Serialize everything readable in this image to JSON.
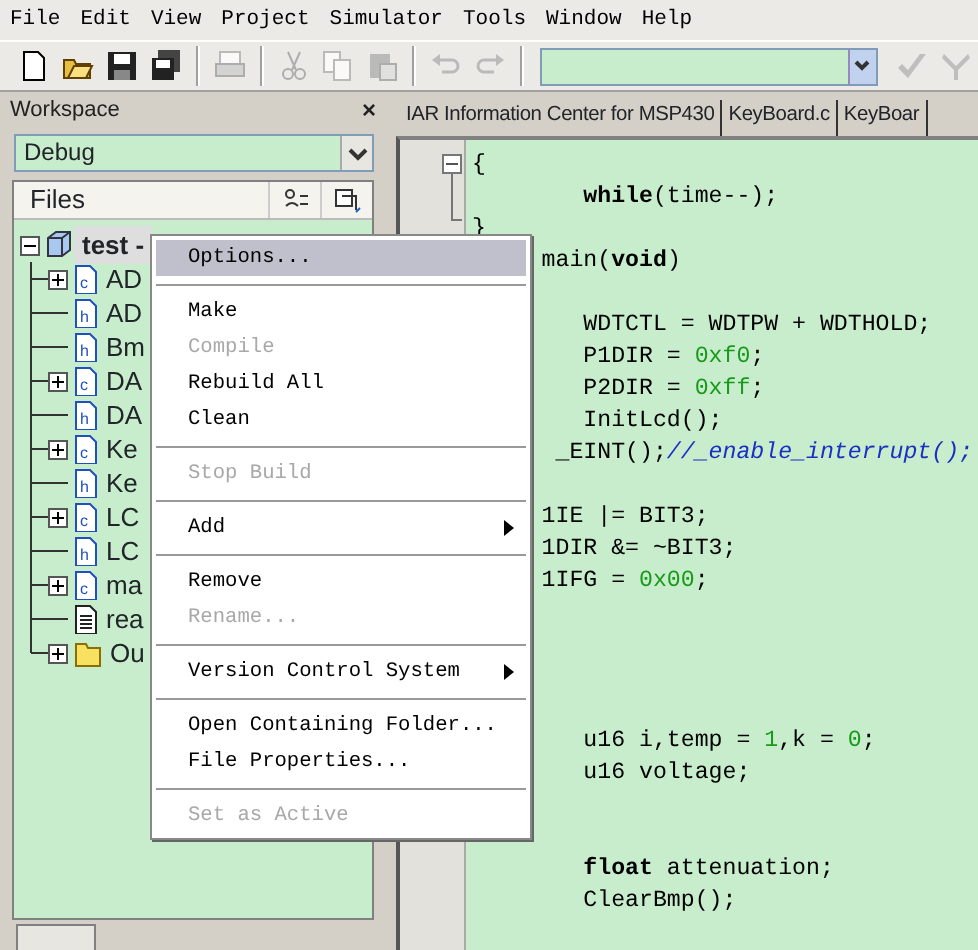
{
  "menu_bar": [
    {
      "label": "File"
    },
    {
      "label": "Edit"
    },
    {
      "label": "View"
    },
    {
      "label": "Project"
    },
    {
      "label": "Simulator"
    },
    {
      "label": "Tools"
    },
    {
      "label": "Window"
    },
    {
      "label": "Help"
    }
  ],
  "toolbar": [
    [
      {
        "kind": "new",
        "disabled": false
      },
      {
        "kind": "open",
        "disabled": false
      },
      {
        "kind": "save",
        "disabled": false
      },
      {
        "kind": "save_all",
        "disabled": false
      }
    ],
    [
      {
        "kind": "print",
        "disabled": true
      }
    ],
    [
      {
        "kind": "cut",
        "disabled": true
      },
      {
        "kind": "copy",
        "disabled": true
      },
      {
        "kind": "paste",
        "disabled": true
      }
    ],
    [
      {
        "kind": "undo",
        "disabled": true
      },
      {
        "kind": "redo",
        "disabled": true
      }
    ],
    [
      {
        "kind": "combo",
        "disabled": false
      },
      {
        "kind": "check",
        "disabled": true
      },
      {
        "kind": "fork",
        "disabled": true
      }
    ]
  ],
  "workspace": {
    "title": "Workspace",
    "close": "×",
    "configuration": "Debug",
    "files_header": "Files",
    "tree": [
      {
        "label": "test -",
        "kind": "project",
        "selected": true,
        "expandable": true,
        "expanded": true,
        "children": [
          {
            "label": "AD",
            "kind": "c",
            "selected": false,
            "expandable": true,
            "expanded": false
          },
          {
            "label": "AD",
            "kind": "h",
            "selected": false,
            "expandable": false
          },
          {
            "label": "Bm",
            "kind": "h",
            "selected": false,
            "expandable": false
          },
          {
            "label": "DA",
            "kind": "c",
            "selected": false,
            "expandable": true,
            "expanded": false
          },
          {
            "label": "DA",
            "kind": "h",
            "selected": false,
            "expandable": false
          },
          {
            "label": "Ke",
            "kind": "c",
            "selected": false,
            "expandable": true,
            "expanded": false
          },
          {
            "label": "Ke",
            "kind": "h",
            "selected": false,
            "expandable": false
          },
          {
            "label": "LC",
            "kind": "c",
            "selected": false,
            "expandable": true,
            "expanded": false
          },
          {
            "label": "LC",
            "kind": "h",
            "selected": false,
            "expandable": false
          },
          {
            "label": "ma",
            "kind": "c",
            "selected": false,
            "expandable": true,
            "expanded": false
          },
          {
            "label": "rea",
            "kind": "text",
            "selected": false,
            "expandable": false
          },
          {
            "label": "Ou",
            "kind": "folder",
            "selected": false,
            "expandable": true,
            "expanded": false
          }
        ]
      }
    ]
  },
  "editor": {
    "tabs": [
      {
        "label": "IAR Information Center for MSP430"
      },
      {
        "label": "KeyBoard.c"
      },
      {
        "label": "KeyBoar"
      }
    ],
    "lines": [
      {
        "kind": "code",
        "tokens": [
          {
            "text": "{",
            "kind": "plain"
          }
        ]
      },
      {
        "kind": "code",
        "tokens": [
          {
            "text": "        while",
            "kind": "keyword"
          },
          {
            "text": "(time--);",
            "kind": "plain"
          }
        ]
      },
      {
        "kind": "code",
        "tokens": [
          {
            "text": "}",
            "kind": "plain"
          }
        ]
      },
      {
        "kind": "code",
        "tokens": [
          {
            "text": "     main(",
            "kind": "plain"
          },
          {
            "text": "void",
            "kind": "keyword"
          },
          {
            "text": ")",
            "kind": "plain"
          }
        ]
      },
      {
        "kind": "blank"
      },
      {
        "kind": "code",
        "tokens": [
          {
            "text": "        WDTCTL = WDTPW + WDTHOLD;",
            "kind": "plain"
          }
        ]
      },
      {
        "kind": "code",
        "tokens": [
          {
            "text": "        P1DIR = ",
            "kind": "plain"
          },
          {
            "text": "0xf0",
            "kind": "number"
          },
          {
            "text": ";",
            "kind": "plain"
          }
        ]
      },
      {
        "kind": "code",
        "tokens": [
          {
            "text": "        P2DIR = ",
            "kind": "plain"
          },
          {
            "text": "0xff",
            "kind": "number"
          },
          {
            "text": ";",
            "kind": "plain"
          }
        ]
      },
      {
        "kind": "code",
        "tokens": [
          {
            "text": "        InitLcd();",
            "kind": "plain"
          }
        ]
      },
      {
        "kind": "code",
        "tokens": [
          {
            "text": "      _EINT();",
            "kind": "plain"
          },
          {
            "text": "//_enable_interrupt();",
            "kind": "comment"
          }
        ]
      },
      {
        "kind": "blank"
      },
      {
        "kind": "code",
        "tokens": [
          {
            "text": "     1IE |= BIT3;",
            "kind": "plain"
          }
        ]
      },
      {
        "kind": "code",
        "tokens": [
          {
            "text": "     1DIR &= ~BIT3;",
            "kind": "plain"
          }
        ]
      },
      {
        "kind": "code",
        "tokens": [
          {
            "text": "     1IFG = ",
            "kind": "plain"
          },
          {
            "text": "0x00",
            "kind": "number"
          },
          {
            "text": ";",
            "kind": "plain"
          }
        ]
      },
      {
        "kind": "blank"
      },
      {
        "kind": "blank"
      },
      {
        "kind": "blank"
      },
      {
        "kind": "blank"
      },
      {
        "kind": "code",
        "tokens": [
          {
            "text": "        u16 i,temp = ",
            "kind": "plain"
          },
          {
            "text": "1",
            "kind": "number"
          },
          {
            "text": ",k = ",
            "kind": "plain"
          },
          {
            "text": "0",
            "kind": "number"
          },
          {
            "text": ";",
            "kind": "plain"
          }
        ]
      },
      {
        "kind": "code",
        "tokens": [
          {
            "text": "        u16 voltage;",
            "kind": "plain"
          }
        ]
      },
      {
        "kind": "blank"
      },
      {
        "kind": "blank"
      },
      {
        "kind": "code",
        "tokens": [
          {
            "text": "        float",
            "kind": "keyword"
          },
          {
            "text": " attenuation;",
            "kind": "plain"
          }
        ]
      },
      {
        "kind": "code",
        "tokens": [
          {
            "text": "        ClearBmp();",
            "kind": "plain"
          }
        ]
      }
    ]
  },
  "context_menu": [
    {
      "kind": "item",
      "label": "Options...",
      "selected": true,
      "disabled": false,
      "submenu": false
    },
    {
      "kind": "separator"
    },
    {
      "kind": "item",
      "label": "Make",
      "selected": false,
      "disabled": false,
      "submenu": false
    },
    {
      "kind": "item",
      "label": "Compile",
      "selected": false,
      "disabled": true,
      "submenu": false
    },
    {
      "kind": "item",
      "label": "Rebuild All",
      "selected": false,
      "disabled": false,
      "submenu": false
    },
    {
      "kind": "item",
      "label": "Clean",
      "selected": false,
      "disabled": false,
      "submenu": false
    },
    {
      "kind": "separator"
    },
    {
      "kind": "item",
      "label": "Stop Build",
      "selected": false,
      "disabled": true,
      "submenu": false
    },
    {
      "kind": "separator"
    },
    {
      "kind": "item",
      "label": "Add",
      "selected": false,
      "disabled": false,
      "submenu": true
    },
    {
      "kind": "separator"
    },
    {
      "kind": "item",
      "label": "Remove",
      "selected": false,
      "disabled": false,
      "submenu": false
    },
    {
      "kind": "item",
      "label": "Rename...",
      "selected": false,
      "disabled": true,
      "submenu": false
    },
    {
      "kind": "separator"
    },
    {
      "kind": "item",
      "label": "Version Control System",
      "selected": false,
      "disabled": false,
      "submenu": true
    },
    {
      "kind": "separator"
    },
    {
      "kind": "item",
      "label": "Open Containing Folder...",
      "selected": false,
      "disabled": false,
      "submenu": false
    },
    {
      "kind": "item",
      "label": "File Properties...",
      "selected": false,
      "disabled": false,
      "submenu": false
    },
    {
      "kind": "separator"
    },
    {
      "kind": "item",
      "label": "Set as Active",
      "selected": false,
      "disabled": true,
      "submenu": false
    }
  ]
}
